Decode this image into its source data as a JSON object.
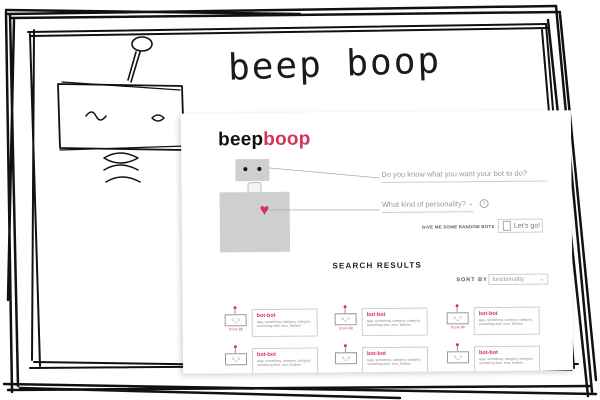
{
  "sketch": {
    "title": "beep boop"
  },
  "wireframe": {
    "brand": {
      "part1": "beep",
      "part2": "boop"
    },
    "colors": {
      "accent": "#d6335d",
      "placeholder": "#cfcfcf"
    },
    "icons": {
      "personality_heart": "heart-icon",
      "dropdown": "chevron-down-icon",
      "info": "info-icon",
      "dice": "dice-icon"
    },
    "question_1": {
      "placeholder": "Do you know what you want your bot to do?"
    },
    "question_2": {
      "placeholder": "What kind of personality?"
    },
    "random_bots_label": "GIVE ME SOME RANDOM BOTS",
    "lets_go_label": "Let's go!",
    "results_heading": "SEARCH RESULTS",
    "sort": {
      "label": "SORT BY",
      "selected": "functionality"
    },
    "results": [
      {
        "name": "bot-bot",
        "score": "Score 88",
        "tags": "tags, something, category, category, something else, emo, bitches"
      },
      {
        "name": "bot-bot",
        "score": "Score 88",
        "tags": "tags, something, category, category, something else, emo, bitches"
      },
      {
        "name": "bot-bot",
        "score": "Score 88",
        "tags": "tags, something, category, category, something else, emo, bitches"
      },
      {
        "name": "bot-bot",
        "score": "",
        "tags": "tags, something, category, category, something else, emo, bitches"
      },
      {
        "name": "bot-bot",
        "score": "",
        "tags": "tags, something, category, category, something else, emo, bitches"
      },
      {
        "name": "bot-bot",
        "score": "",
        "tags": "tags, something, category, category, something else, emo, bitches"
      }
    ]
  }
}
